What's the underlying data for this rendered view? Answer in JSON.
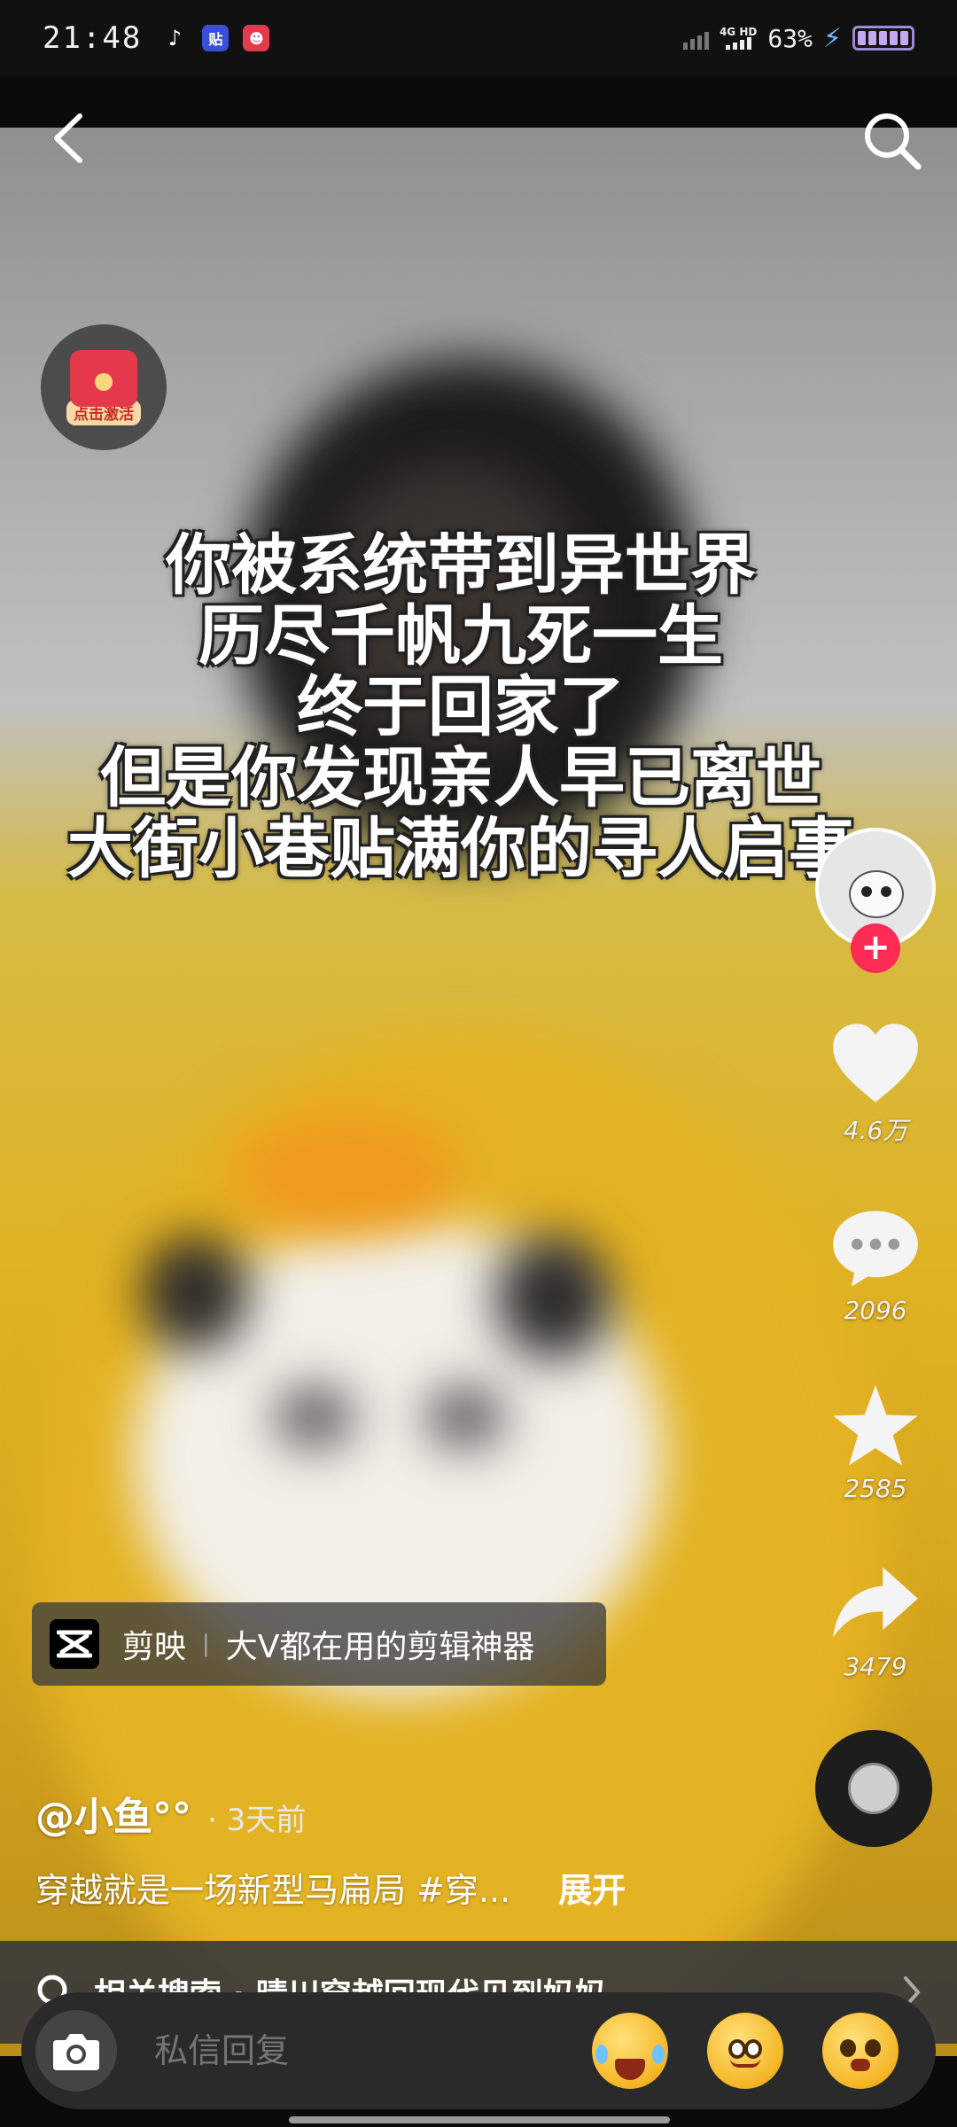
{
  "status_bar": {
    "time": "21:48",
    "notif_tie": "贴",
    "network_top": "4G HD",
    "battery_percent": "63%"
  },
  "video": {
    "overlay_lines": [
      "你被系统带到异世界",
      "历尽千帆九死一生",
      "终于回家了",
      "但是你发现亲人早已离世",
      "大街小巷贴满你的寻人启事"
    ],
    "red_packet_label": "点击激活"
  },
  "actions": {
    "likes": "4.6万",
    "comments": "2096",
    "favorites": "2585",
    "shares": "3479"
  },
  "anchor": {
    "app_name": "剪映",
    "slogan": "大V都在用的剪辑神器"
  },
  "post": {
    "author": "@小鱼°°",
    "time": "· 3天前",
    "caption": "穿越就是一场新型马扁局 #穿...",
    "expand_label": "展开"
  },
  "related_search": {
    "text": "相关搜索 · 晴川穿越回现代见到妈妈"
  },
  "reply_bar": {
    "placeholder": "私信回复"
  },
  "icons": {
    "back": "back-arrow-icon",
    "search": "search-icon",
    "like": "heart-icon",
    "comment": "comment-bubble-icon",
    "favorite": "star-icon",
    "share": "share-arrow-icon",
    "camera": "camera-icon"
  },
  "colors": {
    "follow_accent": "#fe2c55",
    "overlay_text": "#ffffff"
  }
}
